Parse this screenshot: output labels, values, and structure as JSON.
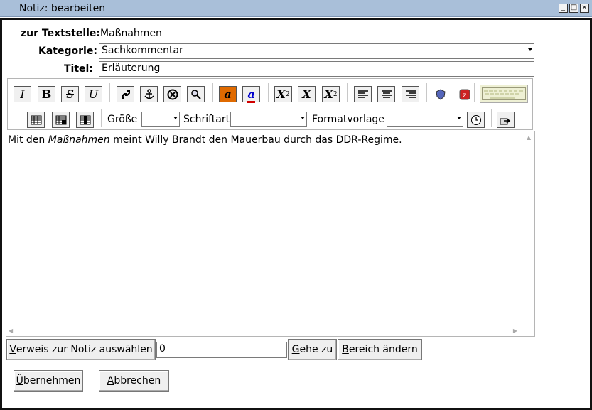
{
  "window": {
    "title": "Notiz: bearbeiten",
    "controls": [
      "minimize",
      "maximize",
      "close"
    ]
  },
  "form": {
    "textstelle_label": "zur Textstelle:",
    "textstelle_value": "Maßnahmen",
    "kategorie_label": "Kategorie:",
    "kategorie_value": "Sachkommentar",
    "titel_label": "Titel:",
    "titel_value": "Erläuterung"
  },
  "toolbar": {
    "groesse_label": "Größe",
    "schriftart_label": "Schriftart",
    "formatvorlage_label": "Formatvorlage",
    "text_color_glyph": "a",
    "highlight_glyph": "a",
    "italic": "I",
    "bold": "B",
    "strike": "S",
    "underline": "U",
    "subscript": "X",
    "normal": "X",
    "superscript": "X",
    "accent_color": "#e06a00",
    "link_color": "#0000cc"
  },
  "editor": {
    "text_before": "Mit den ",
    "text_italic": "Maßnahmen",
    "text_after": " meint Willy Brandt den Mauerbau durch das DDR-Regime."
  },
  "footer": {
    "verweis_button_prefix": "V",
    "verweis_button_rest": "erweis zur Notiz auswählen",
    "verweis_value": "0",
    "gehe_zu_prefix": "G",
    "gehe_zu_rest": "ehe zu",
    "bereich_prefix": "B",
    "bereich_rest": "ereich ändern",
    "uebernehmen_prefix": "Ü",
    "uebernehmen_rest": "bernehmen",
    "abbrechen_prefix": "A",
    "abbrechen_rest": "bbrechen"
  }
}
